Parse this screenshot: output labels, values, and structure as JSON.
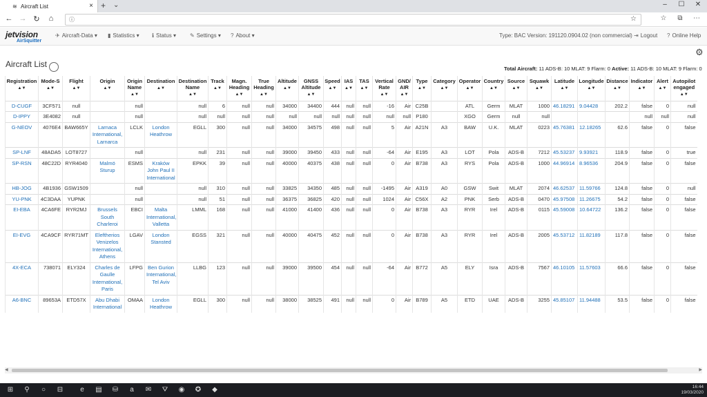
{
  "browser": {
    "tab_title": "Aircraft List",
    "tab_close": "×",
    "new_tab": "+",
    "tab_menu": "⌄",
    "controls": {
      "minimize": "–",
      "maximize": "☐",
      "close": "✕"
    },
    "nav": {
      "back": "←",
      "forward": "→",
      "reload": "↻",
      "home": "⌂"
    },
    "address_info": "ⓘ",
    "address_value": "",
    "right_icons": {
      "star": "☆",
      "favorites": "☆",
      "collections": "⧉",
      "more": "⋯"
    }
  },
  "app": {
    "logo_text": "jetvision",
    "logo_sub": "AirSquitter",
    "menus": [
      {
        "label": "Aircraft-Data ▾",
        "icon": "✈"
      },
      {
        "label": "Statistics ▾",
        "icon": "▮"
      },
      {
        "label": "Status ▾",
        "icon": "ℹ"
      },
      {
        "label": "Settings ▾",
        "icon": "✎"
      },
      {
        "label": "About ▾",
        "icon": "?"
      }
    ],
    "type_info": "Type: BAC Version: 191120.0904.02 (non commercial)",
    "logout": "Logout",
    "online_help": "Online Help"
  },
  "page": {
    "title": "Aircraft List",
    "totals_label": "Total Aircraft:",
    "totals_value": "11 ADS-B: 10 MLAT: 9 Flarm: 0",
    "active_label": "Active:",
    "active_value": "11 ADS-B: 10 MLAT: 9 Flarm: 0",
    "settings_icon": "⚙"
  },
  "table": {
    "sort_glyph": "▲▼",
    "columns": [
      "Registration",
      "Mode-S",
      "Flight",
      "Origin",
      "Origin Name",
      "Destination",
      "Destination Name",
      "Track",
      "Magn. Heading",
      "True Heading",
      "Altitude",
      "GNSS Altitude",
      "Speed",
      "IAS",
      "TAS",
      "Vertical Rate",
      "GND/ AIR",
      "Type",
      "Category",
      "Operator",
      "Country",
      "Source",
      "Squawk",
      "Latitude",
      "Longitude",
      "Distance",
      "Indicator",
      "Alert",
      "Autopilot engaged"
    ],
    "rows": [
      [
        "D-CUGF",
        "3CF571",
        "null",
        "",
        "null",
        "",
        "null",
        "6",
        "null",
        "null",
        "34000",
        "34400",
        "444",
        "null",
        "null",
        "-16",
        "Air",
        "C25B",
        "",
        "ATL",
        "Germ",
        "MLAT",
        "1000",
        "46.18291",
        "9.04428",
        "202.2",
        "false",
        "0",
        "null"
      ],
      [
        "D-IPPY",
        "3E4082",
        "null",
        "",
        "null",
        "",
        "null",
        "null",
        "null",
        "null",
        "null",
        "null",
        "null",
        "null",
        "null",
        "null",
        "null",
        "P180",
        "",
        "XGO",
        "Germ",
        "null",
        "null",
        "",
        "",
        "",
        "null",
        "null",
        "null"
      ],
      [
        "G-NEOV",
        "4076E4",
        "BAW665Y",
        "Larnaca International, Larnarca",
        "LCLK",
        "London Heathrow",
        "EGLL",
        "300",
        "null",
        "null",
        "34000",
        "34575",
        "498",
        "null",
        "null",
        "5",
        "Air",
        "A21N",
        "A3",
        "BAW",
        "U.K.",
        "MLAT",
        "0223",
        "45.76381",
        "12.18265",
        "62.6",
        "false",
        "0",
        "false"
      ],
      [
        "SP-LNF",
        "48ADA5",
        "LOT8727",
        "",
        "null",
        "",
        "null",
        "231",
        "null",
        "null",
        "39000",
        "39450",
        "433",
        "null",
        "null",
        "-64",
        "Air",
        "E195",
        "A3",
        "LOT",
        "Pola",
        "ADS-B",
        "7212",
        "45.53237",
        "9.93921",
        "118.9",
        "false",
        "0",
        "true"
      ],
      [
        "SP-RSN",
        "48C22D",
        "RYR4040",
        "Malmö Sturup",
        "ESMS",
        "Kraków John Paul II International",
        "EPKK",
        "39",
        "null",
        "null",
        "40000",
        "40375",
        "438",
        "null",
        "null",
        "0",
        "Air",
        "B738",
        "A3",
        "RYS",
        "Pola",
        "ADS-B",
        "1000",
        "44.96914",
        "8.96536",
        "204.9",
        "false",
        "0",
        "false"
      ],
      [
        "HB-JOG",
        "4B1936",
        "GSW1509",
        "",
        "null",
        "",
        "null",
        "310",
        "null",
        "null",
        "33825",
        "34350",
        "485",
        "null",
        "null",
        "-1495",
        "Air",
        "A319",
        "A0",
        "GSW",
        "Swit",
        "MLAT",
        "2074",
        "46.62537",
        "11.59766",
        "124.8",
        "false",
        "0",
        "null"
      ],
      [
        "YU-PNK",
        "4C3DAA",
        "YUPNK",
        "",
        "null",
        "",
        "null",
        "51",
        "null",
        "null",
        "36375",
        "36825",
        "420",
        "null",
        "null",
        "1024",
        "Air",
        "C56X",
        "A2",
        "PNK",
        "Serb",
        "ADS-B",
        "0470",
        "45.97508",
        "11.26675",
        "54.2",
        "false",
        "0",
        "false"
      ],
      [
        "EI-EBA",
        "4CA6FE",
        "RYR2MJ",
        "Brussels South Charleroi",
        "EBCI",
        "Malta International, Valletta",
        "LMML",
        "168",
        "null",
        "null",
        "41000",
        "41400",
        "436",
        "null",
        "null",
        "0",
        "Air",
        "B738",
        "A3",
        "RYR",
        "Irel",
        "ADS-B",
        "0115",
        "45.59008",
        "10.64722",
        "136.2",
        "false",
        "0",
        "false"
      ],
      [
        "EI-EVG",
        "4CA9CF",
        "RYR71MT",
        "Eleftherios Venizelos International, Athens",
        "LGAV",
        "London Stansted",
        "EGSS",
        "321",
        "null",
        "null",
        "40000",
        "40475",
        "452",
        "null",
        "null",
        "0",
        "Air",
        "B738",
        "A3",
        "RYR",
        "Irel",
        "ADS-B",
        "2005",
        "45.53712",
        "11.82189",
        "117.8",
        "false",
        "0",
        "false"
      ],
      [
        "4X-ECA",
        "738071",
        "ELY324",
        "Charles de Gaulle International, Paris",
        "LFPG",
        "Ben Gurion International, Tel Aviv",
        "LLBG",
        "123",
        "null",
        "null",
        "39000",
        "39500",
        "454",
        "null",
        "null",
        "-64",
        "Air",
        "B772",
        "A5",
        "ELY",
        "Isra",
        "ADS-B",
        "7567",
        "46.10105",
        "11.57603",
        "66.6",
        "false",
        "0",
        "false"
      ],
      [
        "A6-BNC",
        "89653A",
        "ETD57X",
        "Abu Dhabi International",
        "OMAA",
        "London Heathrow",
        "EGLL",
        "300",
        "null",
        "null",
        "38000",
        "38525",
        "491",
        "null",
        "null",
        "0",
        "Air",
        "B789",
        "A5",
        "ETD",
        "UAE",
        "ADS-B",
        "3255",
        "45.85107",
        "11.94488",
        "53.5",
        "false",
        "0",
        "false"
      ]
    ],
    "link_columns": [
      0,
      3,
      5,
      23,
      24
    ]
  },
  "scrollbar": {
    "left_arrow": "◀",
    "right_arrow": "▶"
  },
  "taskbar": {
    "start": "⊞",
    "search": "⚲",
    "task_view": "○",
    "widgets": "⊟",
    "apps": [
      "e",
      "▤",
      "⛁",
      "a",
      "✉",
      "⛛",
      "◉",
      "✪",
      "◆"
    ],
    "time": "16:44",
    "date": "19/03/2020"
  },
  "colors": {
    "link": "#1f6fb7",
    "taskbar": "#1c1d22",
    "navbar": "#f8f8f8"
  }
}
